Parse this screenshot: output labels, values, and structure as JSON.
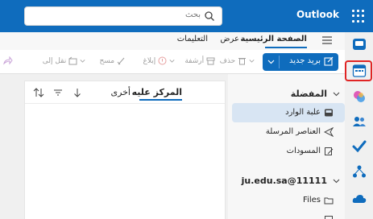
{
  "header": {
    "brand": "Outlook",
    "search_placeholder": "بحث"
  },
  "ribbon": {
    "tabs": [
      {
        "label": "الصفحة الرئيسية",
        "active": true
      },
      {
        "label": "عرض",
        "active": false
      },
      {
        "label": "التعليمات",
        "active": false
      }
    ]
  },
  "toolbar": {
    "new_mail_label": "بريد جديد",
    "delete_label": "حذف",
    "archive_label": "أرشفة",
    "report_label": "إبلاغ",
    "sweep_label": "مسح",
    "move_label": "نقل إلى"
  },
  "folders": {
    "favorites_label": "المفضلة",
    "items": [
      {
        "label": "علبة الوارد",
        "icon": "inbox-icon"
      },
      {
        "label": "العناصر المرسلة",
        "icon": "send-icon"
      },
      {
        "label": "المسودات",
        "icon": "draft-icon"
      }
    ],
    "account_label": "ju.edu.sa@11111",
    "account_items": [
      {
        "label": "Files",
        "icon": "folder-icon"
      }
    ]
  },
  "message_list": {
    "focused_label": "المركز عليه",
    "other_label": "أخرى"
  },
  "colors": {
    "accent": "#0f6cbd",
    "highlight": "#e02424"
  },
  "appbar_icons": [
    "mail-icon",
    "calendar-icon",
    "copilot-icon",
    "people-icon",
    "todo-icon",
    "org-explorer-icon",
    "onedrive-icon"
  ]
}
